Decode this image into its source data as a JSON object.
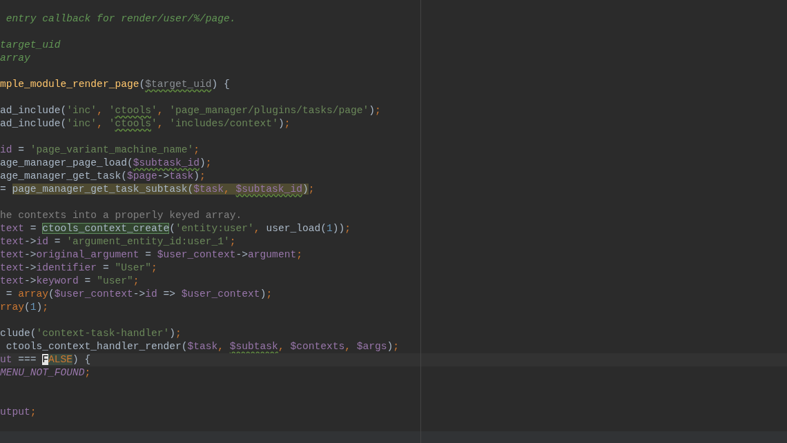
{
  "editor": {
    "lines": [
      {
        "kind": "code",
        "segments": [
          {
            "text": " entry callback for render/user/%/page.",
            "kind": "doc"
          }
        ]
      },
      {
        "kind": "blank"
      },
      {
        "kind": "code",
        "segments": [
          {
            "text": "target_uid",
            "kind": "doc"
          }
        ]
      },
      {
        "kind": "code",
        "segments": [
          {
            "text": "array",
            "kind": "doc"
          }
        ]
      },
      {
        "kind": "blank"
      },
      {
        "kind": "code",
        "segments": [
          {
            "text": "mple_module_render_page",
            "kind": "function"
          },
          {
            "text": "(",
            "kind": "plain"
          },
          {
            "text": "$target_uid",
            "kind": "unused",
            "typo": true
          },
          {
            "text": ") {",
            "kind": "plain"
          }
        ]
      },
      {
        "kind": "blank"
      },
      {
        "kind": "code",
        "segments": [
          {
            "text": "ad_include(",
            "kind": "plain"
          },
          {
            "text": "'inc'",
            "kind": "string"
          },
          {
            "text": ", ",
            "kind": "keyword"
          },
          {
            "text": "'",
            "kind": "string"
          },
          {
            "text": "ctools",
            "kind": "string",
            "typo": true
          },
          {
            "text": "'",
            "kind": "string"
          },
          {
            "text": ", ",
            "kind": "keyword"
          },
          {
            "text": "'page_manager/plugins/tasks/page'",
            "kind": "string"
          },
          {
            "text": ")",
            "kind": "plain"
          },
          {
            "text": ";",
            "kind": "keyword"
          }
        ]
      },
      {
        "kind": "code",
        "segments": [
          {
            "text": "ad_include(",
            "kind": "plain"
          },
          {
            "text": "'inc'",
            "kind": "string"
          },
          {
            "text": ", ",
            "kind": "keyword"
          },
          {
            "text": "'",
            "kind": "string"
          },
          {
            "text": "ctools",
            "kind": "string",
            "typo": true
          },
          {
            "text": "'",
            "kind": "string"
          },
          {
            "text": ", ",
            "kind": "keyword"
          },
          {
            "text": "'includes/context'",
            "kind": "string"
          },
          {
            "text": ")",
            "kind": "plain"
          },
          {
            "text": ";",
            "kind": "keyword"
          }
        ]
      },
      {
        "kind": "blank"
      },
      {
        "kind": "code",
        "segments": [
          {
            "text": "id",
            "kind": "variable"
          },
          {
            "text": " = ",
            "kind": "plain"
          },
          {
            "text": "'page_variant_machine_name'",
            "kind": "string"
          },
          {
            "text": ";",
            "kind": "keyword"
          }
        ]
      },
      {
        "kind": "code",
        "segments": [
          {
            "text": "age_manager_page_load(",
            "kind": "plain"
          },
          {
            "text": "$subtask_id",
            "kind": "variable",
            "typo": true
          },
          {
            "text": ")",
            "kind": "plain"
          },
          {
            "text": ";",
            "kind": "keyword"
          }
        ]
      },
      {
        "kind": "code",
        "segments": [
          {
            "text": "age_manager_get_task(",
            "kind": "plain"
          },
          {
            "text": "$page",
            "kind": "variable"
          },
          {
            "text": "->",
            "kind": "plain"
          },
          {
            "text": "task",
            "kind": "variable"
          },
          {
            "text": ")",
            "kind": "plain"
          },
          {
            "text": ";",
            "kind": "keyword"
          }
        ]
      },
      {
        "kind": "code",
        "segments": [
          {
            "text": "= ",
            "kind": "plain"
          },
          {
            "text": "page_manager_get_task_subtask(",
            "kind": "plain",
            "usage_highlight": true
          },
          {
            "text": "$task",
            "kind": "variable",
            "usage_highlight": true
          },
          {
            "text": ", ",
            "kind": "keyword",
            "usage_highlight": true
          },
          {
            "text": "$subtask_id",
            "kind": "variable",
            "typo": true,
            "usage_highlight": true
          },
          {
            "text": ")",
            "kind": "plain",
            "usage_highlight": true
          },
          {
            "text": ";",
            "kind": "keyword"
          }
        ]
      },
      {
        "kind": "blank"
      },
      {
        "kind": "code",
        "segments": [
          {
            "text": "he contexts into a properly keyed array.",
            "kind": "comment"
          }
        ]
      },
      {
        "kind": "code",
        "segments": [
          {
            "text": "text",
            "kind": "variable"
          },
          {
            "text": " = ",
            "kind": "plain"
          },
          {
            "text": "ctools_context_create",
            "kind": "plain",
            "boxed": true
          },
          {
            "text": "(",
            "kind": "plain"
          },
          {
            "text": "'entity:user'",
            "kind": "string"
          },
          {
            "text": ", ",
            "kind": "keyword"
          },
          {
            "text": "user_load(",
            "kind": "plain"
          },
          {
            "text": "1",
            "kind": "number"
          },
          {
            "text": "))",
            "kind": "plain"
          },
          {
            "text": ";",
            "kind": "keyword"
          }
        ]
      },
      {
        "kind": "code",
        "segments": [
          {
            "text": "text",
            "kind": "variable"
          },
          {
            "text": "->",
            "kind": "plain"
          },
          {
            "text": "id",
            "kind": "variable"
          },
          {
            "text": " = ",
            "kind": "plain"
          },
          {
            "text": "'argument_entity_id:user_1'",
            "kind": "string"
          },
          {
            "text": ";",
            "kind": "keyword"
          }
        ]
      },
      {
        "kind": "code",
        "segments": [
          {
            "text": "text",
            "kind": "variable"
          },
          {
            "text": "->",
            "kind": "plain"
          },
          {
            "text": "original_argument",
            "kind": "variable"
          },
          {
            "text": " = ",
            "kind": "plain"
          },
          {
            "text": "$user_context",
            "kind": "variable"
          },
          {
            "text": "->",
            "kind": "plain"
          },
          {
            "text": "argument",
            "kind": "variable"
          },
          {
            "text": ";",
            "kind": "keyword"
          }
        ]
      },
      {
        "kind": "code",
        "segments": [
          {
            "text": "text",
            "kind": "variable"
          },
          {
            "text": "->",
            "kind": "plain"
          },
          {
            "text": "identifier",
            "kind": "variable"
          },
          {
            "text": " = ",
            "kind": "plain"
          },
          {
            "text": "\"User\"",
            "kind": "string"
          },
          {
            "text": ";",
            "kind": "keyword"
          }
        ]
      },
      {
        "kind": "code",
        "segments": [
          {
            "text": "text",
            "kind": "variable"
          },
          {
            "text": "->",
            "kind": "plain"
          },
          {
            "text": "keyword",
            "kind": "variable"
          },
          {
            "text": " = ",
            "kind": "plain"
          },
          {
            "text": "\"user\"",
            "kind": "string"
          },
          {
            "text": ";",
            "kind": "keyword"
          }
        ]
      },
      {
        "kind": "code",
        "segments": [
          {
            "text": " = ",
            "kind": "plain"
          },
          {
            "text": "array",
            "kind": "keyword"
          },
          {
            "text": "(",
            "kind": "plain"
          },
          {
            "text": "$user_context",
            "kind": "variable"
          },
          {
            "text": "->",
            "kind": "plain"
          },
          {
            "text": "id",
            "kind": "variable"
          },
          {
            "text": " => ",
            "kind": "plain"
          },
          {
            "text": "$user_context",
            "kind": "variable"
          },
          {
            "text": ")",
            "kind": "plain"
          },
          {
            "text": ";",
            "kind": "keyword"
          }
        ]
      },
      {
        "kind": "code",
        "segments": [
          {
            "text": "rray",
            "kind": "keyword"
          },
          {
            "text": "(",
            "kind": "plain"
          },
          {
            "text": "1",
            "kind": "number"
          },
          {
            "text": ")",
            "kind": "plain"
          },
          {
            "text": ";",
            "kind": "keyword"
          }
        ]
      },
      {
        "kind": "blank"
      },
      {
        "kind": "code",
        "segments": [
          {
            "text": "clude(",
            "kind": "plain"
          },
          {
            "text": "'context-task-handler'",
            "kind": "string"
          },
          {
            "text": ")",
            "kind": "plain"
          },
          {
            "text": ";",
            "kind": "keyword"
          }
        ]
      },
      {
        "kind": "code",
        "segments": [
          {
            "text": " ctools_context_handler_render(",
            "kind": "plain"
          },
          {
            "text": "$task",
            "kind": "variable"
          },
          {
            "text": ", ",
            "kind": "keyword"
          },
          {
            "text": "$subtask",
            "kind": "variable",
            "typo": true
          },
          {
            "text": ", ",
            "kind": "keyword"
          },
          {
            "text": "$contexts",
            "kind": "variable"
          },
          {
            "text": ", ",
            "kind": "keyword"
          },
          {
            "text": "$args",
            "kind": "variable"
          },
          {
            "text": ")",
            "kind": "plain"
          },
          {
            "text": ";",
            "kind": "keyword"
          }
        ]
      },
      {
        "kind": "code",
        "current": true,
        "segments": [
          {
            "text": "ut",
            "kind": "variable"
          },
          {
            "text": " === ",
            "kind": "plain"
          },
          {
            "text": "F",
            "kind": "keyword",
            "caret": true
          },
          {
            "text": "ALSE",
            "kind": "keyword",
            "word_highlight": true
          },
          {
            "text": ") {",
            "kind": "plain"
          }
        ]
      },
      {
        "kind": "code",
        "segments": [
          {
            "text": "MENU_NOT_FOUND",
            "kind": "constant"
          },
          {
            "text": ";",
            "kind": "keyword"
          }
        ]
      },
      {
        "kind": "blank"
      },
      {
        "kind": "blank"
      },
      {
        "kind": "code",
        "segments": [
          {
            "text": "utput",
            "kind": "variable"
          },
          {
            "text": ";",
            "kind": "keyword"
          }
        ]
      }
    ]
  }
}
